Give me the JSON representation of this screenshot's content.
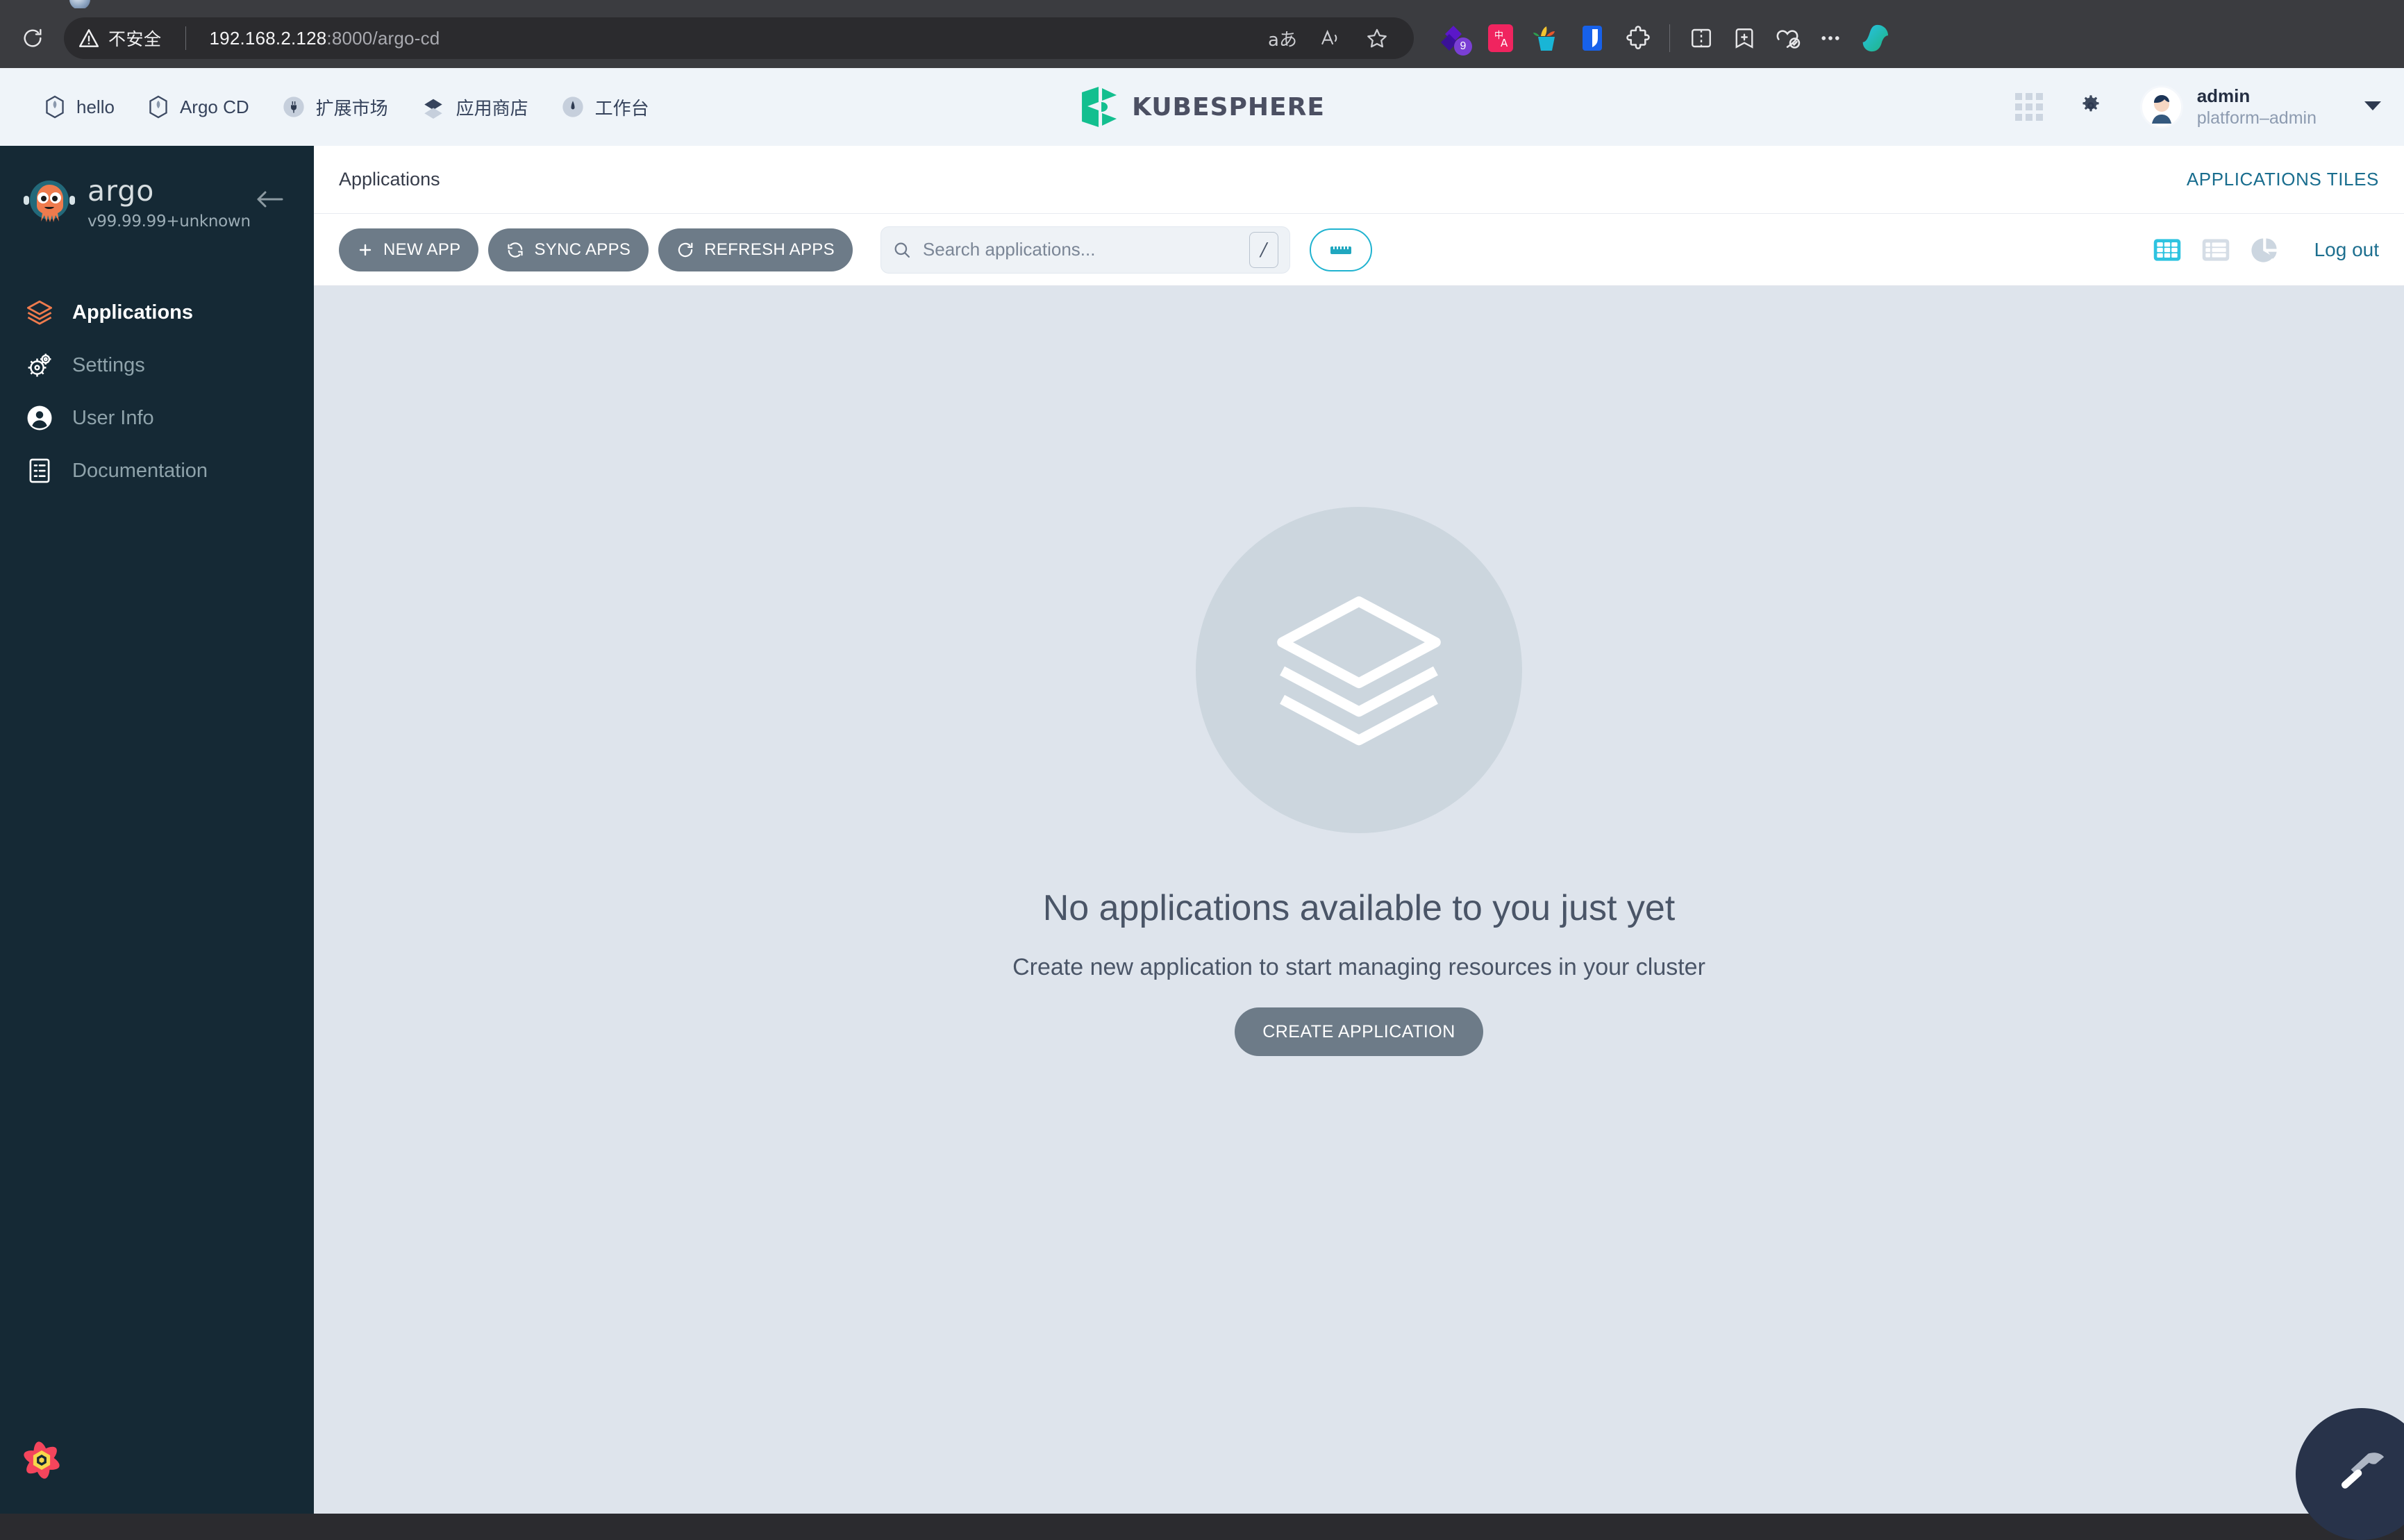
{
  "browser": {
    "reload_icon": "reload-icon",
    "security_icon": "insecure-warning-icon",
    "security_label": "不安全",
    "url_host": "192.168.2.128",
    "url_rest": ":8000/argo-cd",
    "omnibox_right_icons": [
      "reading-aloud-icon",
      "read-aloud-icon",
      "favorite-star-icon"
    ],
    "read_aloud_glyph": "aあ",
    "extensions": [
      {
        "name": "purple-diamond-extension-icon",
        "badge": "9"
      },
      {
        "name": "translate-extension-icon",
        "badge": ""
      },
      {
        "name": "shopping-extension-icon",
        "badge": ""
      },
      {
        "name": "bitwarden-extension-icon",
        "badge": ""
      },
      {
        "name": "extensions-puzzle-icon",
        "badge": ""
      }
    ],
    "right_icons": [
      "split-screen-icon",
      "collections-icon",
      "browser-essentials-icon",
      "settings-more-icon",
      "copilot-icon"
    ]
  },
  "ks_header": {
    "nav": [
      {
        "label": "hello",
        "icon": "hexagon-outline-icon"
      },
      {
        "label": "Argo CD",
        "icon": "hexagon-outline-icon"
      },
      {
        "label": "扩展市场",
        "icon": "plug-circle-icon"
      },
      {
        "label": "应用商店",
        "icon": "layers-diamond-icon"
      },
      {
        "label": "工作台",
        "icon": "compass-circle-icon"
      }
    ],
    "logo_text": "KUBESPHERE",
    "logo_icon": "kubesphere-logo-icon",
    "apps_grid_icon": "app-grid-icon",
    "settings_icon": "gear-icon",
    "user_name": "admin",
    "user_role": "platform–admin",
    "caret_icon": "chevron-down-icon"
  },
  "argo_sidebar": {
    "mascot_icon": "argo-octopus-icon",
    "wordmark": "argo",
    "version": "v99.99.99+unknown",
    "collapse_icon": "arrow-left-icon",
    "items": [
      {
        "label": "Applications",
        "icon": "layers-stack-icon",
        "active": true
      },
      {
        "label": "Settings",
        "icon": "gears-icon",
        "active": false
      },
      {
        "label": "User Info",
        "icon": "user-circle-icon",
        "active": false
      },
      {
        "label": "Documentation",
        "icon": "document-list-icon",
        "active": false
      }
    ],
    "react_devtools_icon": "react-flower-icon"
  },
  "argo_main": {
    "page_title": "Applications",
    "applications_tiles_label": "APPLICATIONS TILES",
    "buttons": {
      "new_app": "NEW APP",
      "sync_apps": "SYNC APPS",
      "refresh_apps": "REFRESH APPS"
    },
    "button_icons": {
      "new_app": "plus-icon",
      "sync_apps": "sync-arrows-icon",
      "refresh_apps": "refresh-icon"
    },
    "search": {
      "placeholder": "Search applications...",
      "value": "",
      "icon": "search-icon",
      "shortcut_key": "/"
    },
    "filter_button_icon": "filter-ruler-icon",
    "view_modes": [
      {
        "name": "tiles-view-icon",
        "active": true
      },
      {
        "name": "list-view-icon",
        "active": false
      },
      {
        "name": "summary-pie-view-icon",
        "active": false
      }
    ],
    "logout_label": "Log out",
    "empty_state": {
      "icon": "layers-stack-icon",
      "title": "No applications available to you just yet",
      "subtitle": "Create new application to start managing resources in your cluster",
      "cta_label": "CREATE APPLICATION"
    },
    "devtools_fab_icon": "hammer-icon"
  },
  "colors": {
    "argo_sidebar_bg": "#152935",
    "argo_content_bg": "#dee4ec",
    "accent_cyan": "#20b3d0",
    "button_grey": "#6d7b88",
    "link_teal": "#1d6f8f",
    "kubesphere_green": "#13bf8f",
    "argo_orange": "#ef7b4d"
  }
}
